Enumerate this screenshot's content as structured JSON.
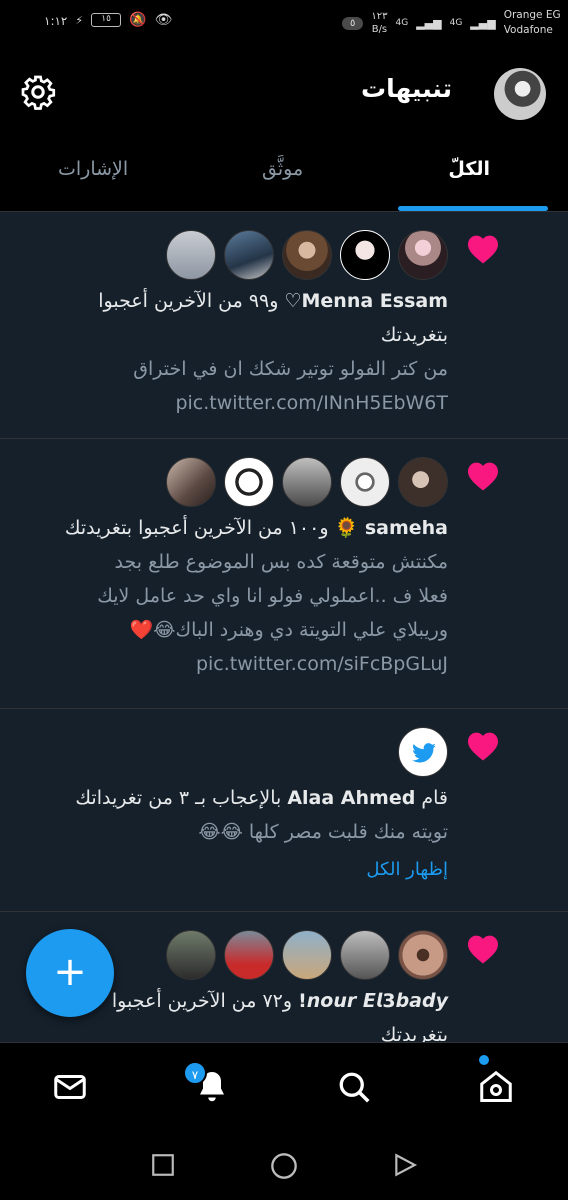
{
  "status_bar": {
    "time": "١:١٢",
    "battery": "١٥",
    "speed_top": "١٢٣",
    "speed_unit": "B/s",
    "signal_1": "4G",
    "signal_2": "4G",
    "badge": "٥",
    "carrier_1": "Orange EG",
    "carrier_2": "Vodafone"
  },
  "header": {
    "title": "تنبيهات"
  },
  "tabs": [
    {
      "label": "الكلّ",
      "active": true
    },
    {
      "label": "موثَّق",
      "active": false
    },
    {
      "label": "الإشارات",
      "active": false
    }
  ],
  "notifications": [
    {
      "name": "Menna Essam♡",
      "summary_suffix": " و٩٩ من الآخرين أعجبوا",
      "summary_line2": "بتغريدتك",
      "text_lines": [
        "من كتر الفولو توتير شكك ان في اختراق"
      ],
      "link": "pic.twitter.com/INnH5EbW6T"
    },
    {
      "name": "sameha 🌻",
      "summary_suffix": " و١٠٠ من الآخرين أعجبوا بتغريدتك",
      "text_lines": [
        "مكنتش متوقعة كده بس الموضوع طلع بجد",
        "فعلا ف ..اعملولي فولو انا واي حد عامل لايك",
        "وريبلاي علي التويتة دي وهنرد الباك😂❤️"
      ],
      "link": "pic.twitter.com/siFcBpGLuJ"
    },
    {
      "prefix": "قام ",
      "name": "Alaa Ahmed",
      "summary_suffix": " بالإعجاب بـ ٣ من تغريداتك",
      "text_lines": [
        "تويته منك قلبت مصر كلها 😂😂"
      ],
      "show_all": "إظهار الكل"
    },
    {
      "name": "𝙣𝙤𝙪𝙧 𝙀𝙡3𝙗𝙖𝙙𝙮!",
      "summary_suffix": " و٧٢ من الآخرين أعجبوا",
      "summary_line2": "بتغريدتك"
    }
  ],
  "bottom_nav": {
    "notifications_badge": "٧"
  },
  "colors": {
    "accent": "#1d9bf0",
    "heart": "#f91880",
    "feed_bg": "#15202b"
  }
}
